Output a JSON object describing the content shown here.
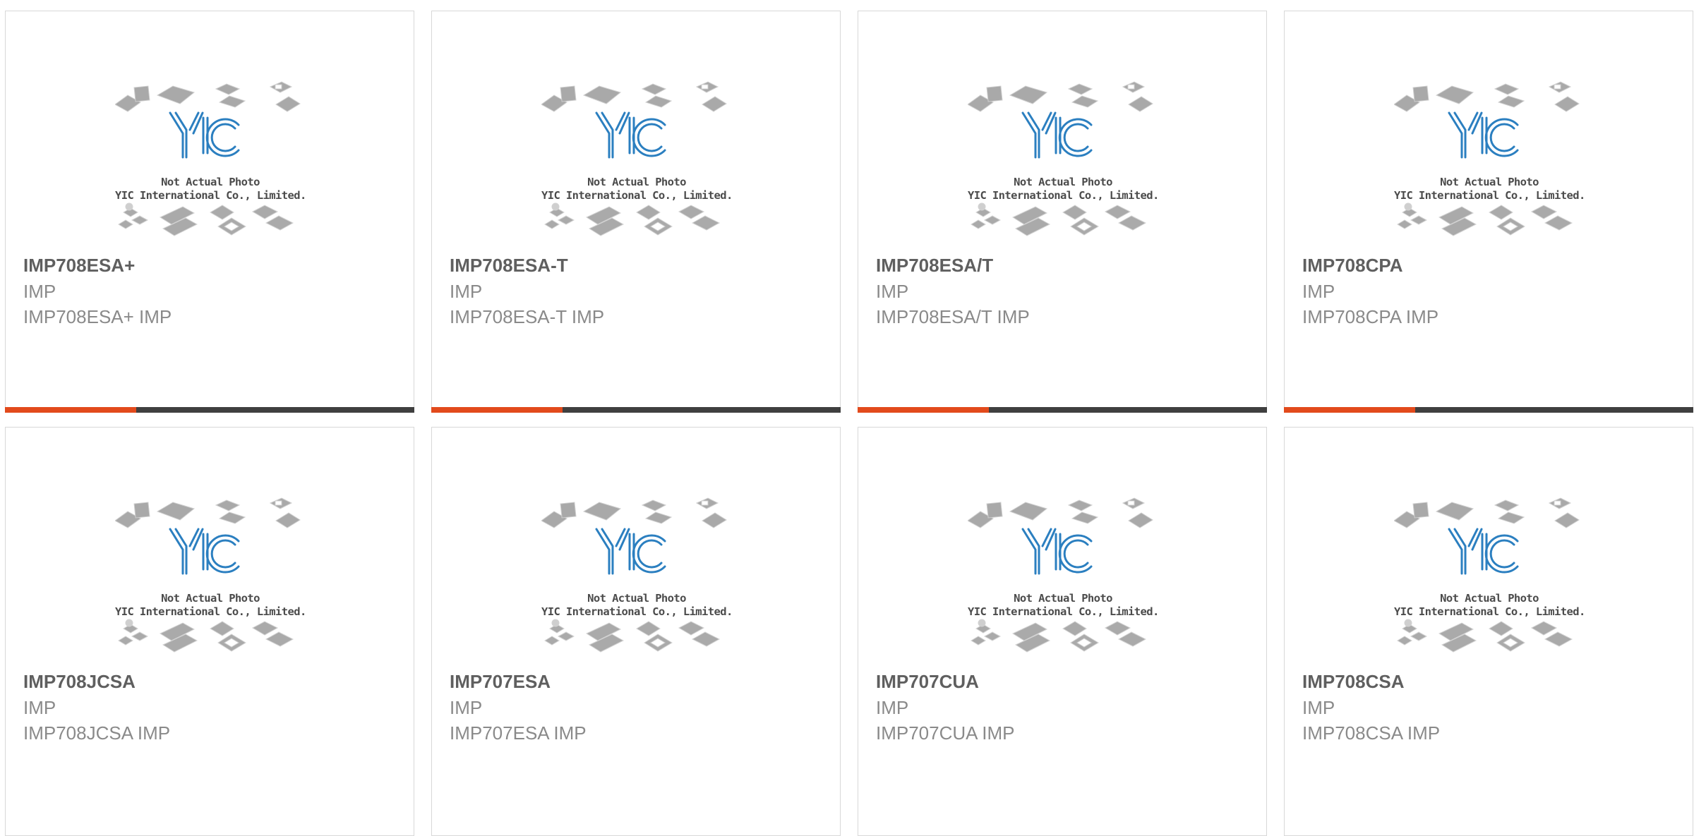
{
  "watermark": {
    "logo_text": "YIC",
    "line1": "Not Actual Photo",
    "line2": "YIC International Co., Limited."
  },
  "colors": {
    "accent": "#e24a1c",
    "bar_dark": "#3f3f3f",
    "logo_blue": "#2b7fc0",
    "chip_gray": "#a8a8a8"
  },
  "products": [
    {
      "part": "IMP708ESA+",
      "brand": "IMP",
      "desc": "IMP708ESA+ IMP",
      "progress": 0.32
    },
    {
      "part": "IMP708ESA-T",
      "brand": "IMP",
      "desc": "IMP708ESA-T IMP",
      "progress": 0.32
    },
    {
      "part": "IMP708ESA/T",
      "brand": "IMP",
      "desc": "IMP708ESA/T IMP",
      "progress": 0.32
    },
    {
      "part": "IMP708CPA",
      "brand": "IMP",
      "desc": "IMP708CPA IMP",
      "progress": 0.32
    },
    {
      "part": "IMP708JCSA",
      "brand": "IMP",
      "desc": "IMP708JCSA IMP"
    },
    {
      "part": "IMP707ESA",
      "brand": "IMP",
      "desc": "IMP707ESA IMP"
    },
    {
      "part": "IMP707CUA",
      "brand": "IMP",
      "desc": "IMP707CUA IMP"
    },
    {
      "part": "IMP708CSA",
      "brand": "IMP",
      "desc": "IMP708CSA IMP"
    }
  ]
}
